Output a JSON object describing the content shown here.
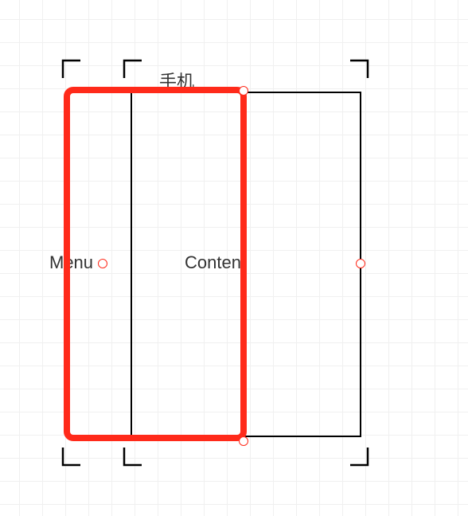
{
  "diagram": {
    "title": "手机",
    "menu_label": "Menu",
    "content_label": "Content"
  }
}
